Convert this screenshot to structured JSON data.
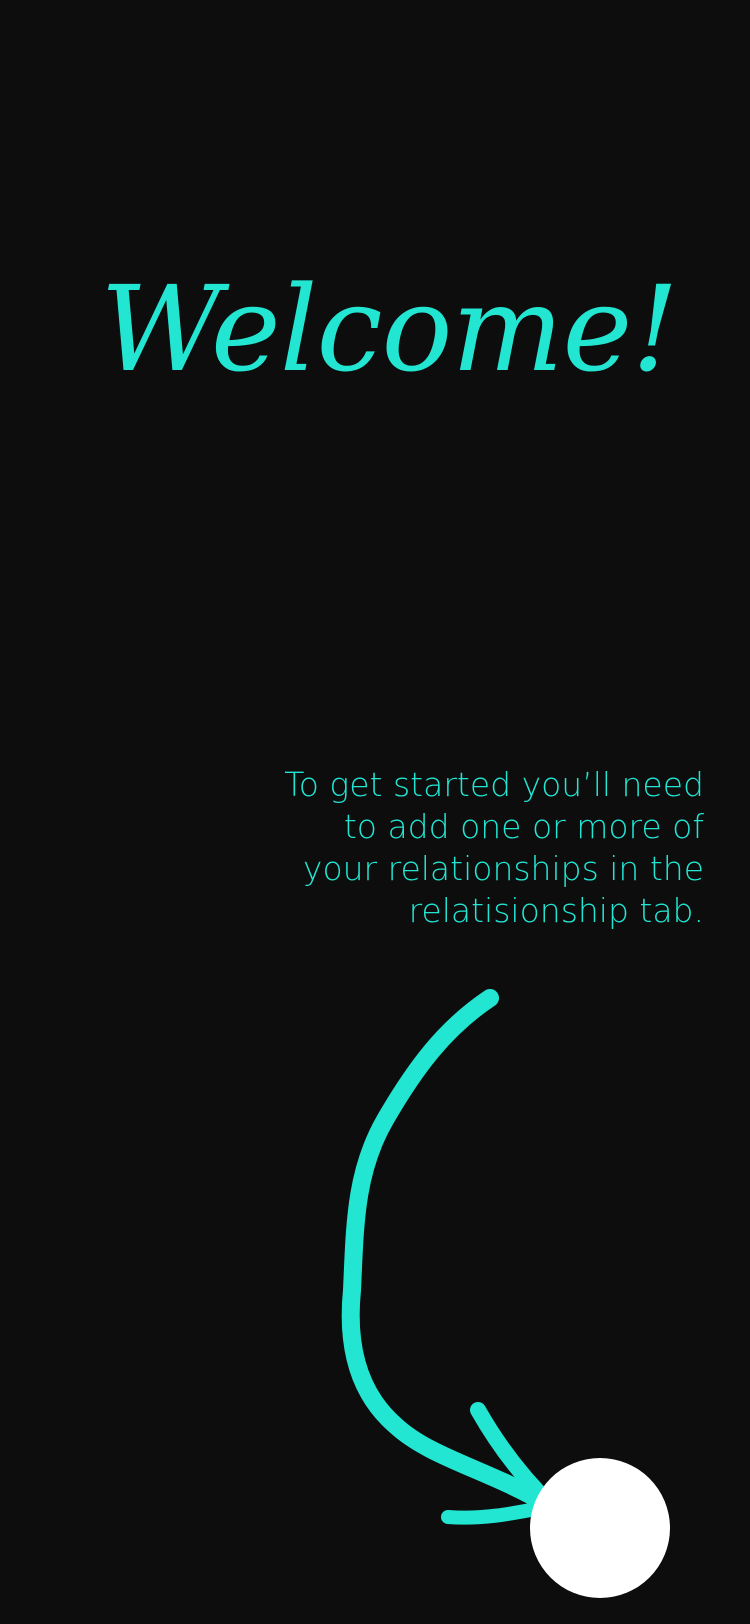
{
  "welcome": {
    "title": "Welcome!"
  },
  "onboarding": {
    "message": "To get started you’ll need\nto add one or more of\nyour relationships in the\nrelatisionship tab."
  },
  "colors": {
    "background": "#0d0d0d",
    "accent": "#22e6d2",
    "target": "#ffffff"
  },
  "icons": {
    "pointer": "curved-arrow-icon",
    "target": "relationship-tab-target"
  }
}
